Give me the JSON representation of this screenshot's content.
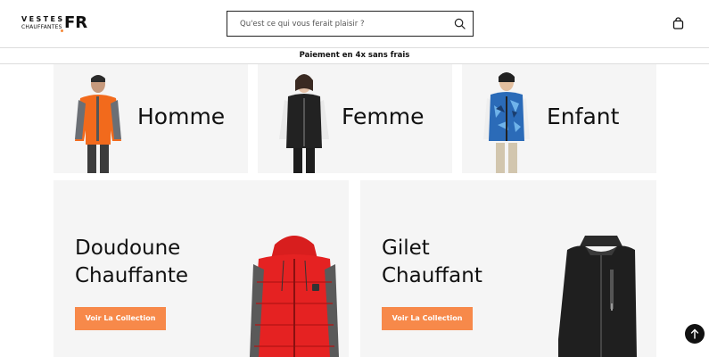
{
  "header": {
    "logo_line1": "VESTES",
    "logo_line2": "CHAUFFANTES",
    "logo_mark": "FR",
    "search_placeholder": "Qu'est ce qui vous ferait plaisir ?",
    "icons": {
      "search": "search-icon",
      "cart": "shopping-bag-icon"
    }
  },
  "promo": {
    "text": "Paiement en 4x sans frais"
  },
  "categories": [
    {
      "label": "Homme"
    },
    {
      "label": "Femme"
    },
    {
      "label": "Enfant"
    }
  ],
  "collections": [
    {
      "title_line1": "Doudoune",
      "title_line2": "Chauffante",
      "button": "Voir La Collection"
    },
    {
      "title_line1": "Gilet",
      "title_line2": "Chauffant",
      "button": "Voir La Collection"
    }
  ],
  "colors": {
    "accent": "#f7894a",
    "card_bg": "#f5f5f5",
    "text": "#111111"
  },
  "scroll_top_icon": "arrow-up-icon"
}
